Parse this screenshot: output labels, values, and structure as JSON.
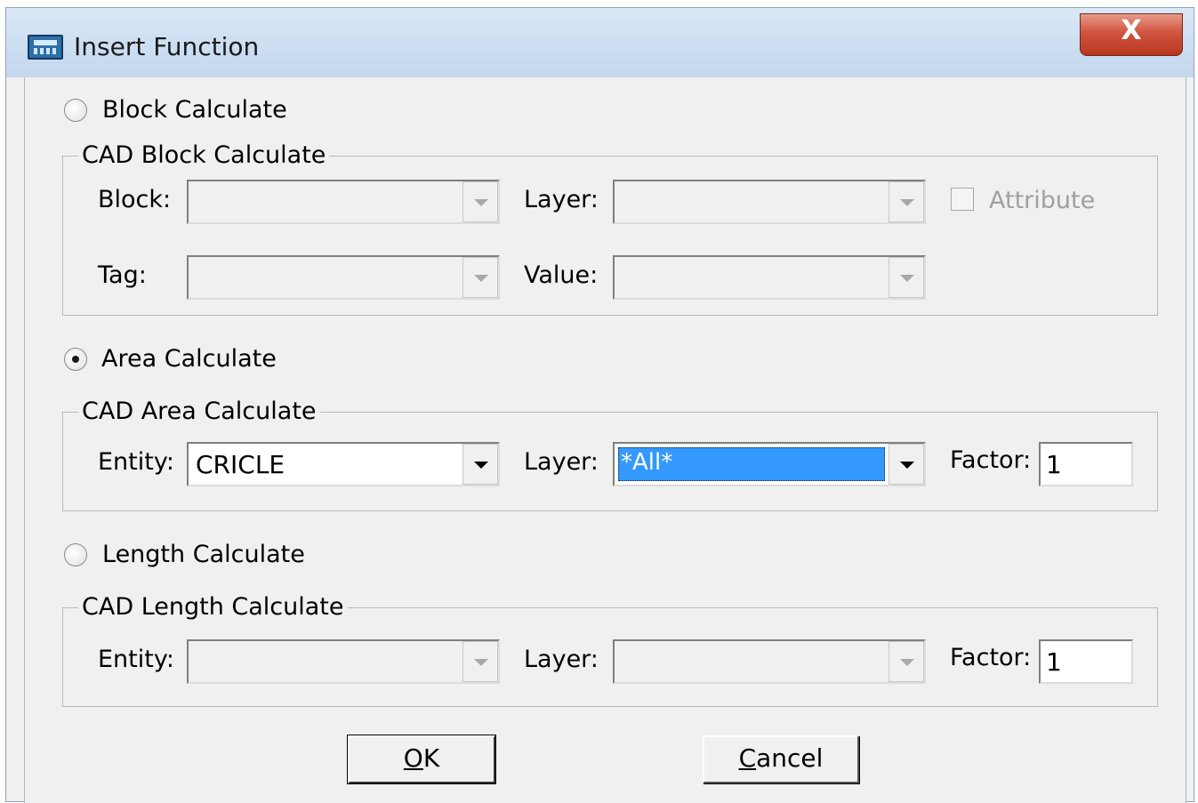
{
  "window": {
    "title": "Insert Function",
    "close_glyph": "X",
    "icon": "calculator-icon"
  },
  "block": {
    "radio_label": "Block Calculate",
    "selected": false,
    "group_title": "CAD Block Calculate",
    "block_label": "Block:",
    "block_value": "",
    "layer_label": "Layer:",
    "layer_value": "",
    "attribute_label": "Attribute",
    "attribute_checked": false,
    "tag_label": "Tag:",
    "tag_value": "",
    "value_label": "Value:",
    "value_value": ""
  },
  "area": {
    "radio_label": "Area Calculate",
    "selected": true,
    "group_title": "CAD Area Calculate",
    "entity_label": "Entity:",
    "entity_value": "CRICLE",
    "layer_label": "Layer:",
    "layer_value": "*All*",
    "factor_label": "Factor:",
    "factor_value": "1"
  },
  "length": {
    "radio_label": "Length Calculate",
    "selected": false,
    "group_title": "CAD Length Calculate",
    "entity_label": "Entity:",
    "entity_value": "",
    "layer_label": "Layer:",
    "layer_value": "",
    "factor_label": "Factor:",
    "factor_value": "1"
  },
  "buttons": {
    "ok_mnemonic": "O",
    "ok_rest": "K",
    "cancel_mnemonic": "C",
    "cancel_rest": "ancel"
  },
  "colors": {
    "selection": "#3399ff",
    "close_button": "#c8472f",
    "dialog_face": "#f0f0f0"
  }
}
